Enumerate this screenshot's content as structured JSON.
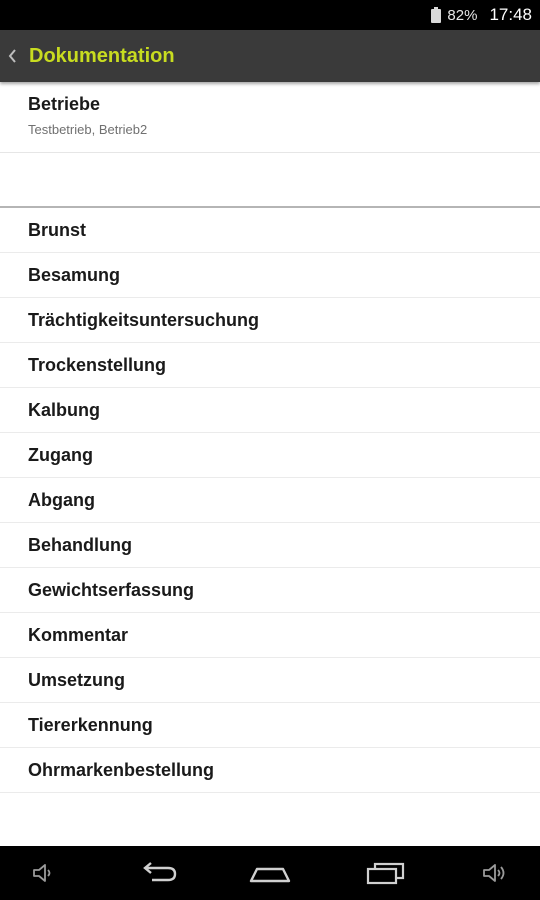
{
  "status_bar": {
    "battery_icon": "battery-icon",
    "battery": "82%",
    "time": "17:48"
  },
  "action_bar": {
    "back_icon": "chevron-left-icon",
    "title": "Dokumentation",
    "title_color": "#c8dc20"
  },
  "betriebe": {
    "title": "Betriebe",
    "subtitle": "Testbetrieb, Betrieb2"
  },
  "menu": {
    "items": [
      {
        "label": "Brunst"
      },
      {
        "label": "Besamung"
      },
      {
        "label": "Trächtigkeitsuntersuchung"
      },
      {
        "label": "Trockenstellung"
      },
      {
        "label": "Kalbung"
      },
      {
        "label": "Zugang"
      },
      {
        "label": "Abgang"
      },
      {
        "label": "Behandlung"
      },
      {
        "label": "Gewichtserfassung"
      },
      {
        "label": "Kommentar"
      },
      {
        "label": "Umsetzung"
      },
      {
        "label": "Tiererkennung"
      },
      {
        "label": "Ohrmarkenbestellung"
      }
    ]
  },
  "nav_bar": {
    "icons": [
      "volume-down-icon",
      "back-icon",
      "home-icon",
      "recent-apps-icon",
      "volume-up-icon"
    ]
  }
}
